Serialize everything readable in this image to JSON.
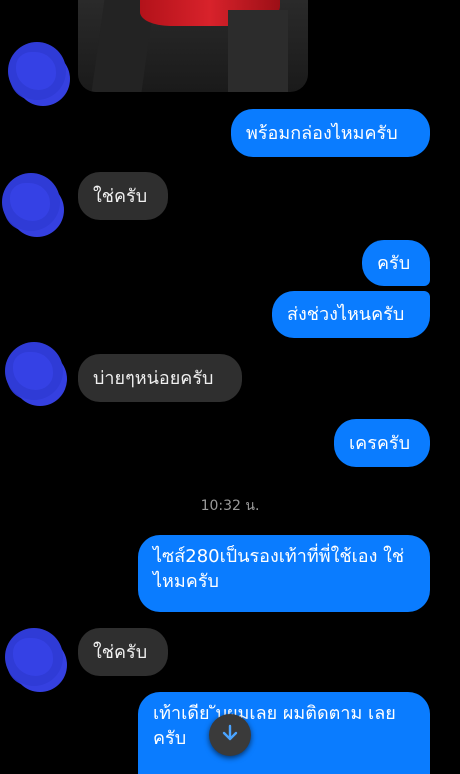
{
  "colors": {
    "background": "#000000",
    "outgoing_bubble": "#0a7cff",
    "incoming_bubble": "#2f2f2f",
    "avatar_blur": "#2f3bd6"
  },
  "messages": [
    {
      "text": "พร้อมกล่องไหมครับ"
    },
    {
      "text": "ใช่ครับ"
    },
    {
      "text": "ครับ"
    },
    {
      "text": "ส่งช่วงไหนครับ"
    },
    {
      "text": "บ่ายๆหน่อยครับ"
    },
    {
      "text": "เครครับ"
    },
    {
      "text": "ไซส์280เป็นรองเท้าที่พี่ใช้เอง ใช่ไหมครับ"
    },
    {
      "text": "ใช่ครับ"
    },
    {
      "text": "เท้าเดีย   ับผมเลย ผมติดตาม เลยครับ"
    }
  ],
  "timestamp": "10:32 น.",
  "icons": {
    "scroll_down": "arrow-down-icon",
    "avatar": "blurred-avatar"
  }
}
